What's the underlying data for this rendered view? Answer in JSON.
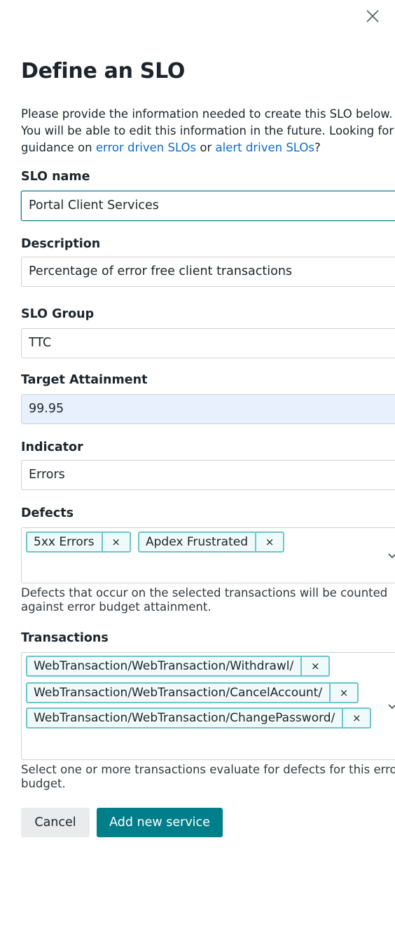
{
  "dialog": {
    "title": "Define an SLO",
    "intro": {
      "line1": "Please provide the information needed to create this SLO below.",
      "line2": "You will be able to edit this information in the future. Looking for",
      "line3_prefix": "guidance on ",
      "link1": "error driven SLOs",
      "line3_middle": " or ",
      "link2": "alert driven SLOs",
      "line3_suffix": "?"
    },
    "link_color": "#0b6acb"
  },
  "form": {
    "slo_name": {
      "label": "SLO name",
      "value": "Portal Client Services"
    },
    "description": {
      "label": "Description",
      "value": "Percentage of error free client transactions"
    },
    "slo_group": {
      "label": "SLO Group",
      "value": "TTC"
    },
    "target": {
      "label": "Target Attainment",
      "value": "99.95"
    },
    "indicator": {
      "label": "Indicator",
      "value": "Errors"
    },
    "defects": {
      "label": "Defects",
      "tags": [
        "5xx Errors",
        "Apdex Frustrated"
      ],
      "hint_line1": "Defects that occur on the selected transactions will be counted",
      "hint_line2": "against error budget attainment."
    },
    "transactions": {
      "label": "Transactions",
      "tags": [
        "WebTransaction/WebTransaction/Withdrawl/",
        "WebTransaction/WebTransaction/CancelAccount/",
        "WebTransaction/WebTransaction/ChangePassword/"
      ],
      "hint_line1": "Select one or more transactions evaluate for defects for this error",
      "hint_line2": "budget."
    },
    "tag_remove_glyph": "×"
  },
  "actions": {
    "cancel_label": "Cancel",
    "submit_label": "Add new service",
    "primary_color": "#007e8a"
  },
  "icons": {
    "close": "close-icon",
    "dropdown": "chevron-down-icon"
  }
}
